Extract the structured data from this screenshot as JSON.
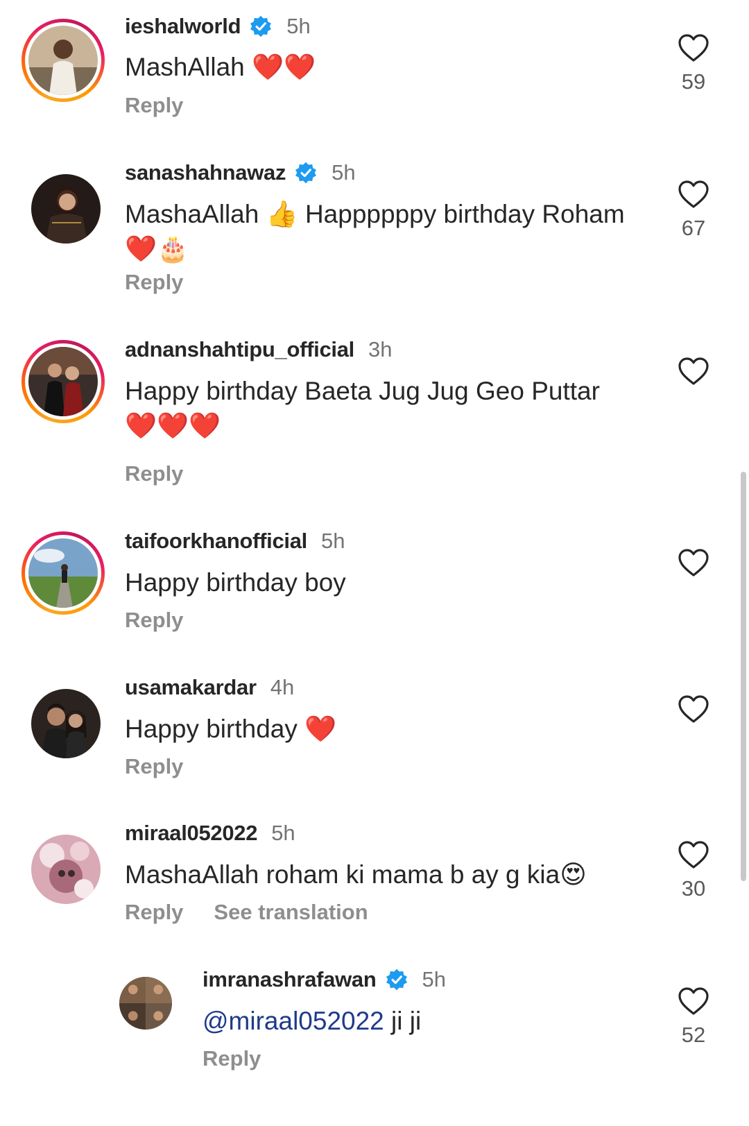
{
  "colors": {
    "text": "#262626",
    "muted": "#737373",
    "verified": "#1d9bf0",
    "mention": "#1e3a8a",
    "heart": "#e0202b"
  },
  "comments": [
    {
      "username": "ieshalworld",
      "verified": true,
      "time": "5h",
      "text": "MashAllah ❤️❤️",
      "reply_label": "Reply",
      "likes": "59",
      "story_ring": true
    },
    {
      "username": "sanashahnawaz",
      "verified": true,
      "time": "5h",
      "text_line1": "MashaAllah 👍 Happppppy birthday Roham",
      "text_line2": "❤️🎂",
      "reply_label": "Reply",
      "likes": "67",
      "story_ring": false
    },
    {
      "username": "adnanshahtipu_official",
      "verified": false,
      "time": "3h",
      "text_line1": "Happy birthday Baeta Jug Jug Geo Puttar",
      "text_line2": "❤️❤️❤️",
      "reply_label": "Reply",
      "likes": "",
      "story_ring": true
    },
    {
      "username": "taifoorkhanofficial",
      "verified": false,
      "time": "5h",
      "text": "Happy birthday boy",
      "reply_label": "Reply",
      "likes": "",
      "story_ring": true
    },
    {
      "username": "usamakardar",
      "verified": false,
      "time": "4h",
      "text": "Happy birthday ❤️",
      "reply_label": "Reply",
      "likes": "",
      "story_ring": false
    },
    {
      "username": "miraal052022",
      "verified": false,
      "time": "5h",
      "text": "MashaAllah roham ki mama b ay g kia😍",
      "reply_label": "Reply",
      "see_translation_label": "See translation",
      "likes": "30",
      "story_ring": false
    },
    {
      "username": "imranashrafawan",
      "verified": true,
      "time": "5h",
      "mention": "@miraal052022",
      "text_after_mention": " ji ji",
      "reply_label": "Reply",
      "likes": "52",
      "story_ring": false,
      "is_reply": true
    }
  ],
  "icons": {
    "verified": "verified-badge-icon",
    "like": "heart-outline-icon"
  }
}
